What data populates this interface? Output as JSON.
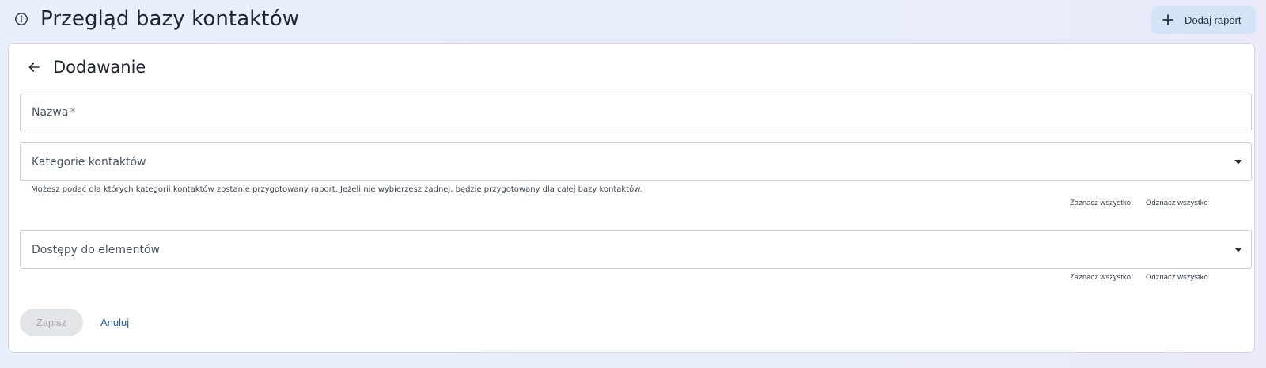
{
  "header": {
    "title": "Przegląd bazy kontaktów",
    "info_icon": "info-circle-icon",
    "add_report_label": "Dodaj raport",
    "add_report_icon": "plus-icon",
    "accent_color": "#d3e4f8"
  },
  "form": {
    "title": "Dodawanie",
    "back_icon": "arrow-left-icon",
    "name_field": {
      "label": "Nazwa",
      "required_mark": "*",
      "value": ""
    },
    "categories_field": {
      "label": "Kategorie kontaktów",
      "value": "",
      "hint": "Możesz podać dla których kategorii kontaktów zostanie przygotowany raport. Jeżeli nie wybierzesz żadnej, będzie przygotowany dla całej bazy kontaktów.",
      "select_all": "Zaznacz wszystko",
      "deselect_all": "Odznacz wszystko"
    },
    "access_field": {
      "label": "Dostępy do elementów",
      "value": "",
      "select_all": "Zaznacz wszystko",
      "deselect_all": "Odznacz wszystko"
    },
    "save_label": "Zapisz",
    "cancel_label": "Anuluj",
    "link_color": "#1d5d9e"
  }
}
